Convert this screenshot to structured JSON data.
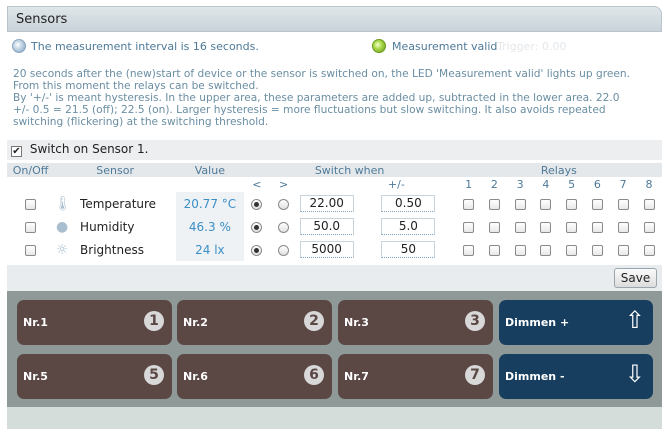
{
  "header": {
    "title": "Sensors"
  },
  "status": {
    "interval_text": "The measurement interval is 16 seconds.",
    "valid_text": "Measurement valid",
    "trigger_text": "Trigger: 0.00"
  },
  "info": {
    "line1": "20 seconds after the (new)start of device or the sensor is switched on, the LED 'Measurement valid' lights up green.",
    "line2": "From this moment the relays can be switched.",
    "line3": "By '+/-' is meant hysteresis. In the upper area, these parameters are added up, subtracted in the lower area. 22.0",
    "line4": "+/- 0.5 = 21.5 (off); 22.5 (on). Larger hysteresis = more fluctuations but slow switching. It also avoids repeated",
    "line5": "switching (flickering) at the switching threshold."
  },
  "switch_on": {
    "label": "Switch on Sensor 1.",
    "checked_mark": "✔"
  },
  "table": {
    "headers": {
      "onoff": "On/Off",
      "sensor": "Sensor",
      "value": "Value",
      "switch_when": "Switch when",
      "relays": "Relays"
    },
    "sub": {
      "lt": "<",
      "gt": ">",
      "hyst": "+/-"
    },
    "relay_numbers": [
      "1",
      "2",
      "3",
      "4",
      "5",
      "6",
      "7",
      "8"
    ],
    "rows": [
      {
        "name": "Temperature",
        "icon": "thermometer-icon",
        "value": "20.77 °C",
        "threshold": "22.00",
        "hysteresis": "0.50"
      },
      {
        "name": "Humidity",
        "icon": "droplet-icon",
        "value": "46.3 %",
        "threshold": "50.0",
        "hysteresis": "5.0"
      },
      {
        "name": "Brightness",
        "icon": "sun-icon",
        "value": "24 lx",
        "threshold": "5000",
        "hysteresis": "50"
      }
    ]
  },
  "footer": {
    "save_label": "Save"
  },
  "tiles": [
    {
      "label": "Nr.1",
      "num": "1"
    },
    {
      "label": "Nr.2",
      "num": "2"
    },
    {
      "label": "Nr.3",
      "num": "3"
    },
    {
      "label": "Dimmen +",
      "arrow": "⇧"
    },
    {
      "label": "Nr.5",
      "num": "5"
    },
    {
      "label": "Nr.6",
      "num": "6"
    },
    {
      "label": "Nr.7",
      "num": "7"
    },
    {
      "label": "Dimmen -",
      "arrow": "⇩"
    }
  ],
  "colors": {
    "header_bg": "#c9d3d9",
    "tile_brown": "#5b4845",
    "tile_blue": "#173e5f",
    "link_blue": "#4e7a99",
    "value_blue": "#3b8fc7"
  }
}
